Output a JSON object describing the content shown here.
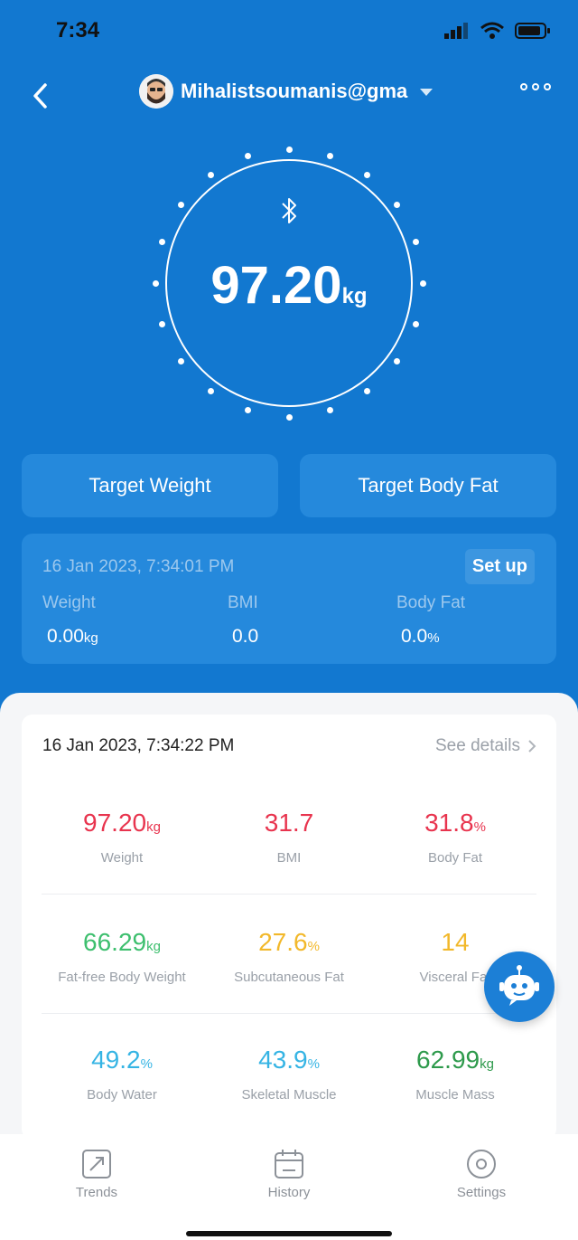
{
  "status_bar": {
    "time": "7:34"
  },
  "header": {
    "profile_name": "Mihalistsoumanis@gma"
  },
  "dial": {
    "weight": "97.20",
    "unit": "kg"
  },
  "targets": {
    "weight_label": "Target Weight",
    "body_fat_label": "Target Body Fat"
  },
  "target_card": {
    "date": "16 Jan 2023, 7:34:01 PM",
    "setup_label": "Set up",
    "items": [
      {
        "label": "Weight",
        "value": "0.00",
        "unit": "kg"
      },
      {
        "label": "BMI",
        "value": "0.0",
        "unit": ""
      },
      {
        "label": "Body Fat",
        "value": "0.0",
        "unit": "%"
      }
    ]
  },
  "details": {
    "date": "16 Jan 2023, 7:34:22 PM",
    "see_details": "See details",
    "metrics": [
      {
        "value": "97.20",
        "unit": "kg",
        "label": "Weight",
        "color": "#e8344e"
      },
      {
        "value": "31.7",
        "unit": "",
        "label": "BMI",
        "color": "#e8344e"
      },
      {
        "value": "31.8",
        "unit": "%",
        "label": "Body Fat",
        "color": "#e8344e"
      },
      {
        "value": "66.29",
        "unit": "kg",
        "label": "Fat-free Body Weight",
        "color": "#3dbf6e"
      },
      {
        "value": "27.6",
        "unit": "%",
        "label": "Subcutaneous Fat",
        "color": "#f2b82a"
      },
      {
        "value": "14",
        "unit": "",
        "label": "Visceral Fat",
        "color": "#f2b82a"
      },
      {
        "value": "49.2",
        "unit": "%",
        "label": "Body Water",
        "color": "#35b4e4"
      },
      {
        "value": "43.9",
        "unit": "%",
        "label": "Skeletal Muscle",
        "color": "#35b4e4"
      },
      {
        "value": "62.99",
        "unit": "kg",
        "label": "Muscle Mass",
        "color": "#2e9a4c"
      }
    ]
  },
  "nav": {
    "trends": "Trends",
    "history": "History",
    "settings": "Settings"
  },
  "icons": {
    "back": "chevron-left-icon",
    "more": "more-icon",
    "bluetooth": "bluetooth-icon",
    "trends": "trends-icon",
    "history": "calendar-icon",
    "settings": "settings-icon",
    "bot": "chatbot-icon"
  },
  "colors": {
    "primary": "#1278d0",
    "card": "#2589dc"
  }
}
